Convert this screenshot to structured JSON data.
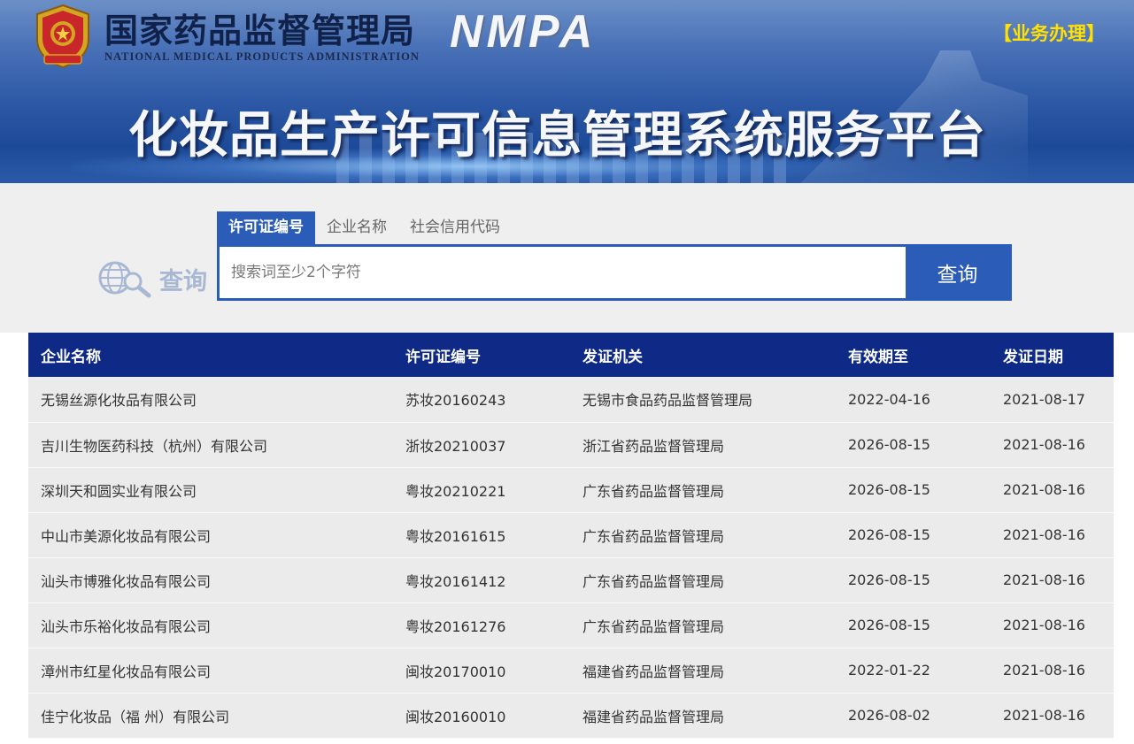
{
  "header": {
    "agency_cn": "国家药品监督管理局",
    "agency_en": "NATIONAL MEDICAL PRODUCTS ADMINISTRATION",
    "agency_abbr": "NMPA",
    "business_link": "【业务办理】",
    "platform_title": "化妆品生产许可信息管理系统服务平台"
  },
  "colors": {
    "brand_blue": "#2a5cb8",
    "table_header": "#0e2a86",
    "link_yellow": "#ffe000"
  },
  "search": {
    "logo_text": "查询",
    "tabs": [
      {
        "label": "许可证编号",
        "active": true
      },
      {
        "label": "企业名称",
        "active": false
      },
      {
        "label": "社会信用代码",
        "active": false
      }
    ],
    "placeholder": "搜索词至少2个字符",
    "button": "查询"
  },
  "table": {
    "columns": [
      "企业名称",
      "许可证编号",
      "发证机关",
      "有效期至",
      "发证日期"
    ],
    "rows": [
      [
        "无锡丝源化妆品有限公司",
        "苏妆20160243",
        "无锡市食品药品监督管理局",
        "2022-04-16",
        "2021-08-17"
      ],
      [
        "吉川生物医药科技（杭州）有限公司",
        "浙妆20210037",
        "浙江省药品监督管理局",
        "2026-08-15",
        "2021-08-16"
      ],
      [
        "深圳天和圆实业有限公司",
        "粤妆20210221",
        "广东省药品监督管理局",
        "2026-08-15",
        "2021-08-16"
      ],
      [
        "中山市美源化妆品有限公司",
        "粤妆20161615",
        "广东省药品监督管理局",
        "2026-08-15",
        "2021-08-16"
      ],
      [
        "汕头市博雅化妆品有限公司",
        "粤妆20161412",
        "广东省药品监督管理局",
        "2026-08-15",
        "2021-08-16"
      ],
      [
        "汕头市乐裕化妆品有限公司",
        "粤妆20161276",
        "广东省药品监督管理局",
        "2026-08-15",
        "2021-08-16"
      ],
      [
        "漳州市红星化妆品有限公司",
        "闽妆20170010",
        "福建省药品监督管理局",
        "2022-01-22",
        "2021-08-16"
      ],
      [
        "佳宁化妆品（福 州）有限公司",
        "闽妆20160010",
        "福建省药品监督管理局",
        "2026-08-02",
        "2021-08-16"
      ]
    ]
  }
}
